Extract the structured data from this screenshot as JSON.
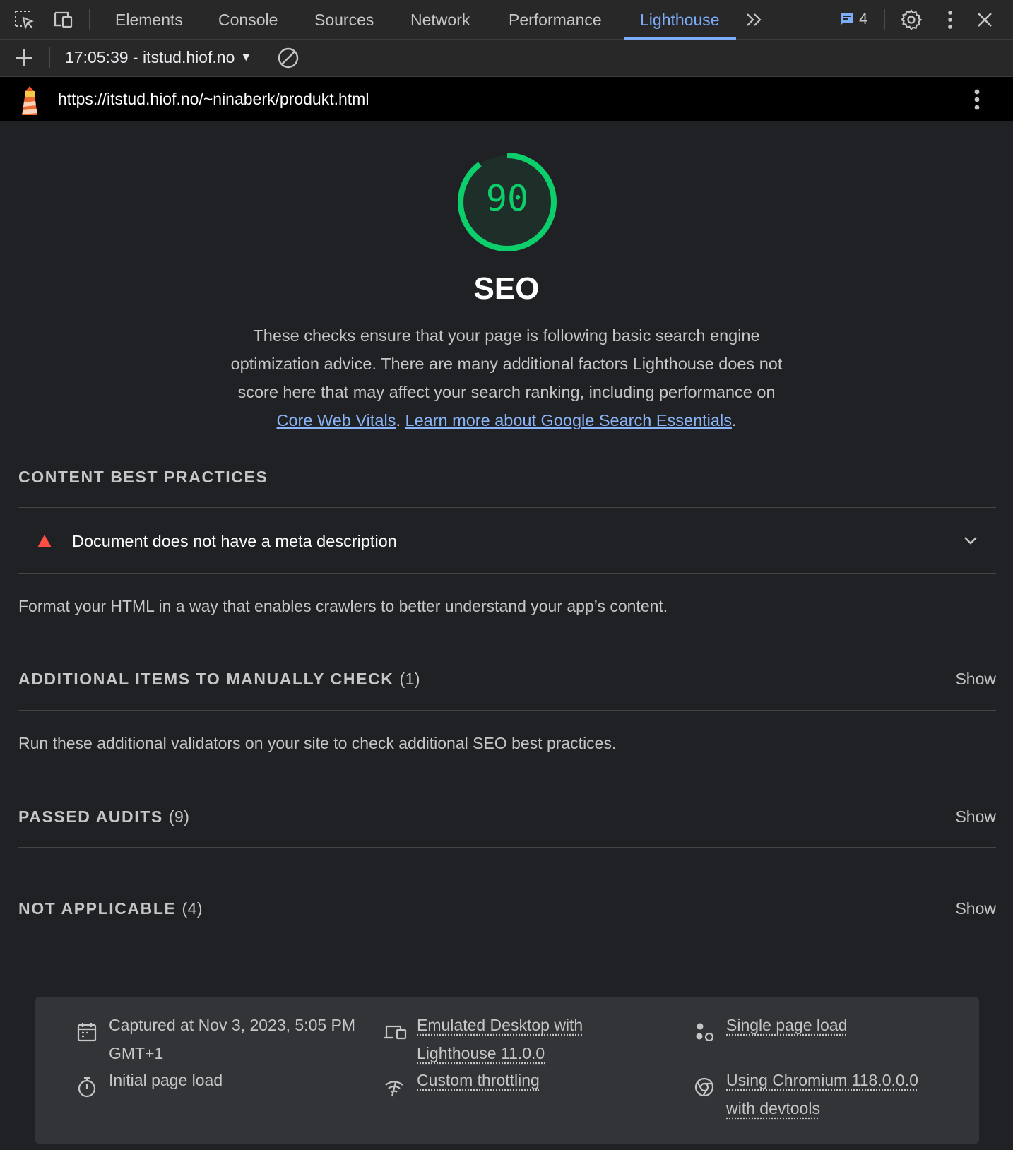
{
  "tabs": [
    {
      "label": "Elements"
    },
    {
      "label": "Console"
    },
    {
      "label": "Sources"
    },
    {
      "label": "Network"
    },
    {
      "label": "Performance"
    },
    {
      "label": "Lighthouse",
      "active": true
    }
  ],
  "issues_badge": {
    "count": "4",
    "icon": "message-icon"
  },
  "report_selector": {
    "label": "17:05:39 - itstud.hiof.no"
  },
  "url": "https://itstud.hiof.no/~ninaberk/produkt.html",
  "category": {
    "score": "90",
    "score_fraction": 0.9,
    "score_color": "#0cce6b",
    "title": "SEO",
    "desc_before": "These checks ensure that your page is following basic search engine optimization advice. There are many additional factors Lighthouse does not score here that may affect your search ranking, including performance on ",
    "link1": "Core Web Vitals",
    "desc_mid": ". ",
    "link2": "Learn more about Google Search Essentials",
    "desc_after": "."
  },
  "groups": {
    "content": {
      "title": "CONTENT BEST PRACTICES",
      "audit": {
        "title": "Document does not have a meta description",
        "status_color": "#ff4e42"
      },
      "description": "Format your HTML in a way that enables crawlers to better understand your app’s content."
    },
    "manual": {
      "title": "ADDITIONAL ITEMS TO MANUALLY CHECK",
      "count": "(1)",
      "show": "Show",
      "description": "Run these additional validators on your site to check additional SEO best practices."
    },
    "passed": {
      "title": "PASSED AUDITS",
      "count": "(9)",
      "show": "Show"
    },
    "not_applicable": {
      "title": "NOT APPLICABLE",
      "count": "(4)",
      "show": "Show"
    }
  },
  "footer": {
    "captured": "Captured at Nov 3, 2023, 5:05 PM GMT+1",
    "initial_load": "Initial page load",
    "emulated": "Emulated Desktop with Lighthouse 11.0.0",
    "throttling": "Custom throttling",
    "single_load": "Single page load",
    "chromium": "Using Chromium 118.0.0.0 with devtools"
  }
}
